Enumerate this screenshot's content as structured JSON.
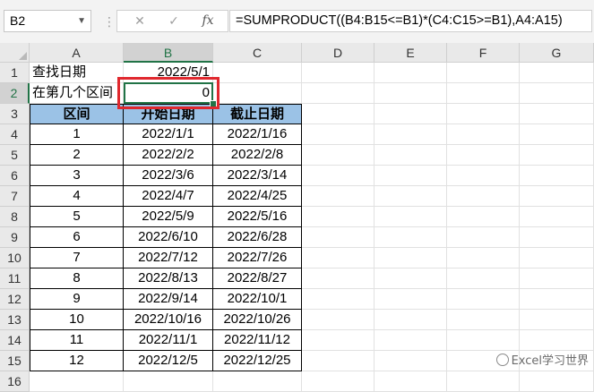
{
  "formula_bar": {
    "name_box": "B2",
    "formula": "=SUMPRODUCT((B4:B15<=B1)*(C4:C15>=B1),A4:A15)",
    "cancel_glyph": "✕",
    "enter_glyph": "✓",
    "fx_label": "fx"
  },
  "columns": [
    "A",
    "B",
    "C",
    "D",
    "E",
    "F",
    "G"
  ],
  "rows": [
    "1",
    "2",
    "3",
    "4",
    "5",
    "6",
    "7",
    "8",
    "9",
    "10",
    "11",
    "12",
    "13",
    "14",
    "15",
    "16"
  ],
  "cells": {
    "a1": "查找日期",
    "b1": "2022/5/1",
    "a2": "在第几个区间",
    "b2": "0"
  },
  "table": {
    "headers": [
      "区间",
      "开始日期",
      "截止日期"
    ],
    "rows": [
      [
        "1",
        "2022/1/1",
        "2022/1/16"
      ],
      [
        "2",
        "2022/2/2",
        "2022/2/8"
      ],
      [
        "3",
        "2022/3/6",
        "2022/3/14"
      ],
      [
        "4",
        "2022/4/7",
        "2022/4/25"
      ],
      [
        "5",
        "2022/5/9",
        "2022/5/16"
      ],
      [
        "6",
        "2022/6/10",
        "2022/6/28"
      ],
      [
        "7",
        "2022/7/12",
        "2022/7/26"
      ],
      [
        "8",
        "2022/8/13",
        "2022/8/27"
      ],
      [
        "9",
        "2022/9/14",
        "2022/10/1"
      ],
      [
        "10",
        "2022/10/16",
        "2022/10/26"
      ],
      [
        "11",
        "2022/11/1",
        "2022/11/12"
      ],
      [
        "12",
        "2022/12/5",
        "2022/12/25"
      ]
    ]
  },
  "watermark": "Excel学习世界",
  "colors": {
    "header_fill": "#9bc2e6",
    "selection": "#217346",
    "highlight": "#e0282e"
  }
}
